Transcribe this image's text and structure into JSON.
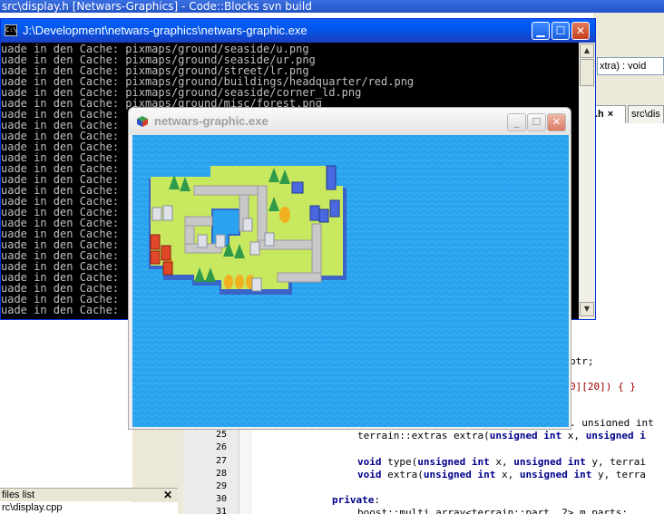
{
  "codeblocks": {
    "title": "src\\display.h [Netwars-Graphics] - Code::Blocks svn build",
    "function_box": "xtra) : void",
    "tabs": [
      {
        "label": ".h",
        "close": "×"
      },
      {
        "label": "src\\dis"
      }
    ],
    "line_numbers": [
      "25",
      "26",
      "27",
      "28",
      "29",
      "30",
      "31"
    ],
    "code_fragments": {
      "ptr": "ptr;",
      "array_tail": "0][20]) { }",
      "unsigned_int_frag": ", unsigned int"
    },
    "files_panel": {
      "header": "files list",
      "close": "✕",
      "item": "rc\\display.cpp"
    }
  },
  "console": {
    "title": "J:\\Development\\netwars-graphics\\netwars-graphic.exe",
    "icon_text": "C:\\",
    "lines": [
      "uade in den Cache: pixmaps/ground/seaside/u.png",
      "uade in den Cache: pixmaps/ground/seaside/ur.png",
      "uade in den Cache: pixmaps/ground/street/lr.png",
      "uade in den Cache: pixmaps/ground/buildings/headquarter/red.png",
      "uade in den Cache: pixmaps/ground/seaside/corner_ld.png",
      "uade in den Cache: pixmaps/ground/misc/forest.png",
      "uade in den Cache:",
      "uade in den Cache:",
      "uade in den Cache:",
      "uade in den Cache:",
      "uade in den Cache:",
      "uade in den Cache:",
      "uade in den Cache:",
      "uade in den Cache:",
      "uade in den Cache:",
      "uade in den Cache:",
      "uade in den Cache:",
      "uade in den Cache:",
      "uade in den Cache:",
      "uade in den Cache:",
      "uade in den Cache:",
      "uade in den Cache:",
      "uade in den Cache:",
      "uade in den Cache:",
      "uade in den Cache:"
    ]
  },
  "game": {
    "title": "netwars-graphic.exe",
    "colors": {
      "sea": "#29a3ef",
      "grass": "#c8e860",
      "road": "#c8c8c8",
      "shore": "#3a64c8"
    }
  },
  "icons": {
    "console_icon": "console-icon",
    "game_icon": "cube-icon",
    "min": "minimize-icon",
    "max": "maximize-icon",
    "close": "close-icon"
  }
}
